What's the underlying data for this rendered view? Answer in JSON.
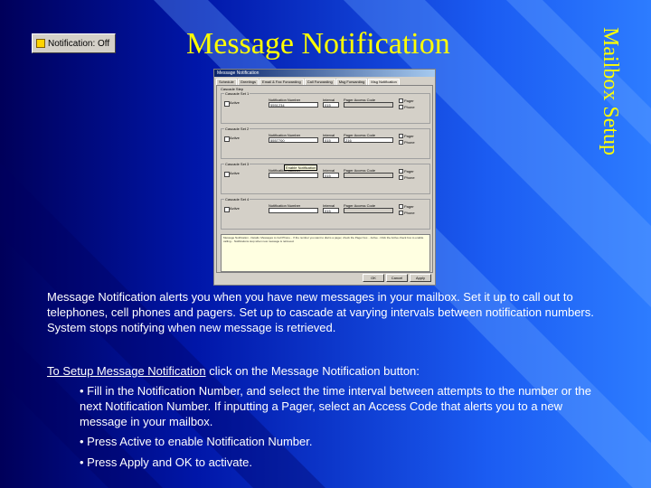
{
  "slide": {
    "title": "Message Notification",
    "side_label": "Mailbox Setup",
    "notification_button": {
      "label": "Notification: Off",
      "icon": "bell-icon"
    },
    "paragraph": "Message Notification alerts you when you have new messages in your mailbox.  Set it up to call out to telephones, cell phones and pagers.  Set up to cascade at varying intervals between notification numbers.  System stops notifying when new message is retrieved.",
    "setup_link": "To Setup Message Notification",
    "setup_rest": " click on the Message Notification button:",
    "bullets": [
      "• Fill in the Notification Number, and select the time interval between attempts to the number or the next Notification Number.  If inputting a Pager, select an Access Code that alerts you to a new message in your mailbox.",
      "• Press Active to enable Notification Number.",
      "• Press Apply and OK to activate."
    ],
    "colors": {
      "title": "#ffff00",
      "text": "#ffffff",
      "bg_dark": "#00005a",
      "bg_light": "#2d7cff"
    }
  },
  "dialog": {
    "title": "Message Notification",
    "tabs": [
      "Schedule",
      "Greetings",
      "Email & Fax Forwarding",
      "Call Forwarding",
      "Msg Forwarding",
      "Msg Notification"
    ],
    "selected_tab": "Msg Notification",
    "group": "Cascade Step",
    "sets": [
      {
        "legend": "Cascade Set 1",
        "active": "Active",
        "number_label": "Notification Number",
        "number": "5551234",
        "interval_label": "Interval",
        "interval": "015",
        "code_label": "Pager Access Code",
        "code": "",
        "pager": "Pager",
        "phone": "Phone"
      },
      {
        "legend": "Cascade Set 2",
        "active": "Active",
        "number_label": "Notification Number",
        "number": "5557700",
        "interval_label": "Interval",
        "interval": "015",
        "code_label": "Pager Access Code",
        "code": "216",
        "pager": "Pager",
        "phone": "Phone"
      },
      {
        "legend": "Cascade Set 3",
        "active": "Active",
        "number_label": "Notification Number",
        "number": "",
        "interval_label": "Interval",
        "interval": "015",
        "code_label": "Pager Access Code",
        "code": "",
        "pager": "Pager",
        "phone": "Phone"
      },
      {
        "legend": "Cascade Set 4",
        "active": "Active",
        "number_label": "Notification Number",
        "number": "",
        "interval_label": "Interval",
        "interval": "015",
        "code_label": "Pager Access Code",
        "code": "",
        "pager": "Pager",
        "phone": "Phone"
      }
    ],
    "tooltip": "Enable Notification",
    "note": "Message Notification - Details: Messages to Cell Phone... If the number you want to dial is a pager, check the Pager box... Active - Click the Active check box to enable calling... Notifications stop when new message is retrieved.",
    "buttons": [
      "OK",
      "Cancel",
      "Apply"
    ]
  }
}
